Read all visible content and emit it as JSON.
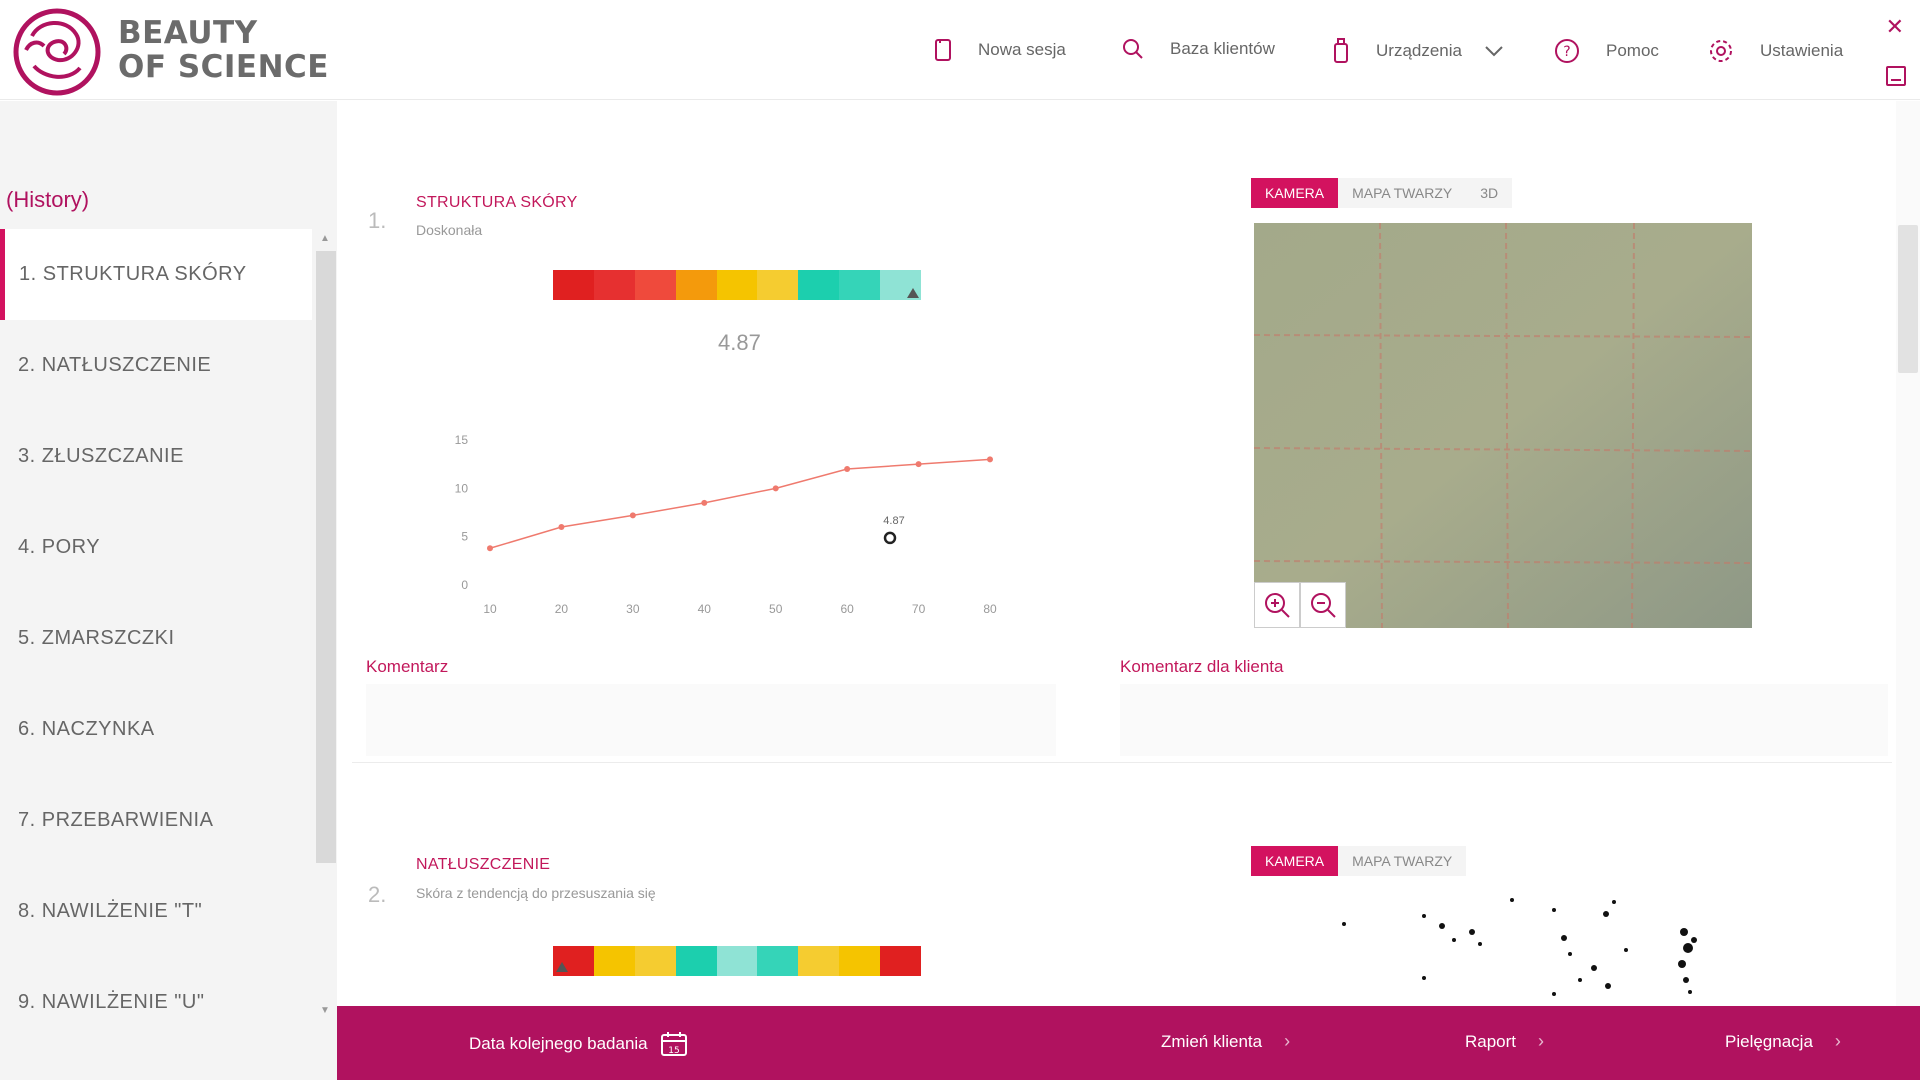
{
  "brand": {
    "line1": "BEAUTY",
    "line2": "OF SCIENCE"
  },
  "nav": {
    "new_session": "Nowa sesja",
    "clients": "Baza klientów",
    "devices": "Urządzenia",
    "help": "Pomoc",
    "settings": "Ustawienia"
  },
  "sidebar": {
    "history": "(History)",
    "items": [
      "1. STRUKTURA SKÓRY",
      "2. NATŁUSZCZENIE",
      "3. ZŁUSZCZANIE",
      "4. PORY",
      "5. ZMARSZCZKI",
      "6. NACZYNKA",
      "7. PRZEBARWIENIA",
      "8. NAWILŻENIE \"T\"",
      "9. NAWILŻENIE \"U\""
    ]
  },
  "section1": {
    "num": "1.",
    "title": "STRUKTURA SKÓRY",
    "subtitle": "Doskonała",
    "score": "4.87",
    "scale_colors": [
      "#e02020",
      "#e63030",
      "#ef4a3c",
      "#f49a0c",
      "#f5c400",
      "#f5cc30",
      "#1ccfae",
      "#35d4b8",
      "#8fe3d5"
    ],
    "tabs": [
      "KAMERA",
      "MAPA TWARZY",
      "3D"
    ],
    "comment_label": "Komentarz",
    "client_comment_label": "Komentarz dla klienta"
  },
  "section2": {
    "num": "2.",
    "title": "NATŁUSZCZENIE",
    "subtitle": "Skóra z tendencją do przesuszania się",
    "scale_colors": [
      "#e02020",
      "#f5c400",
      "#f5cc30",
      "#1ccfae",
      "#8fe3d5",
      "#35d4b8",
      "#f5cc30",
      "#f5c400",
      "#e02020"
    ],
    "tabs": [
      "KAMERA",
      "MAPA TWARZY"
    ]
  },
  "chart_data": {
    "type": "line",
    "x": [
      10,
      20,
      30,
      40,
      50,
      60,
      70,
      80
    ],
    "y": [
      3.8,
      6,
      7.2,
      8.5,
      10,
      12,
      12.5,
      13
    ],
    "xlim": [
      10,
      80
    ],
    "ylim": [
      0,
      15
    ],
    "yticks": [
      "0",
      "5",
      "10",
      "15"
    ],
    "xticks": [
      "10",
      "20",
      "30",
      "40",
      "50",
      "60",
      "70",
      "80"
    ],
    "marker": {
      "x": 66,
      "y": 4.87,
      "label": "4.87"
    },
    "color": "#ef7a6e"
  },
  "footer": {
    "next_exam": "Data kolejnego badania",
    "calendar_day": "15",
    "change_client": "Zmień klienta",
    "report": "Raport",
    "care": "Pielęgnacja"
  },
  "colors": {
    "accent": "#b0125f",
    "accent_tab": "#d3125f"
  }
}
